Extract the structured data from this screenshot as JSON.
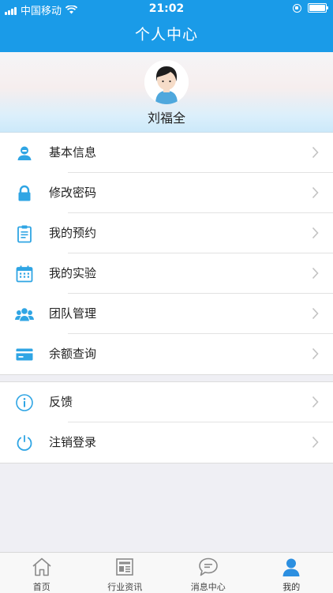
{
  "status_bar": {
    "carrier": "中国移动",
    "time": "21:02"
  },
  "nav": {
    "title": "个人中心"
  },
  "profile": {
    "name": "刘福全"
  },
  "menu_main": [
    {
      "label": "基本信息",
      "icon": "user-info-icon"
    },
    {
      "label": "修改密码",
      "icon": "lock-icon"
    },
    {
      "label": "我的预约",
      "icon": "clipboard-icon"
    },
    {
      "label": "我的实验",
      "icon": "calendar-icon"
    },
    {
      "label": "团队管理",
      "icon": "team-icon"
    },
    {
      "label": "余额查询",
      "icon": "card-icon"
    }
  ],
  "menu_account": [
    {
      "label": "反馈",
      "icon": "info-icon"
    },
    {
      "label": "注销登录",
      "icon": "power-icon"
    }
  ],
  "tabs": [
    {
      "label": "首页",
      "icon": "home-icon"
    },
    {
      "label": "行业资讯",
      "icon": "news-icon"
    },
    {
      "label": "消息中心",
      "icon": "message-icon"
    },
    {
      "label": "我的",
      "icon": "person-icon",
      "active": true
    }
  ],
  "colors": {
    "brand": "#1a9be8",
    "icon_accent": "#2fa5e4",
    "background": "#efeff4"
  }
}
